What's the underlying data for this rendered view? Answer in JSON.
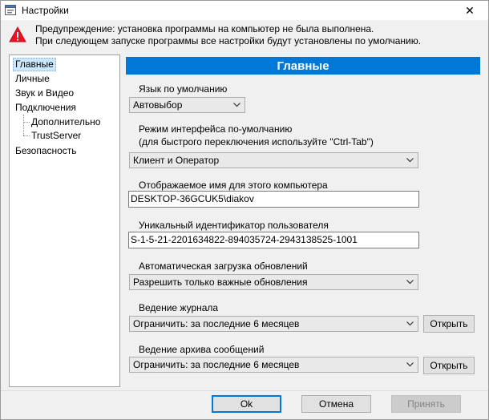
{
  "window": {
    "title": "Настройки",
    "close_glyph": "✕"
  },
  "warning": {
    "line1": "Предупреждение: установка программы на компьютер не была выполнена.",
    "line2": "При следующем запуске программы все настройки будут установлены по умолчанию."
  },
  "tree": {
    "items": [
      {
        "label": "Главные",
        "selected": true
      },
      {
        "label": "Личные"
      },
      {
        "label": "Звук и Видео"
      },
      {
        "label": "Подключения"
      },
      {
        "label": "Дополнительно"
      },
      {
        "label": "TrustServer"
      },
      {
        "label": "Безопасность"
      }
    ]
  },
  "panel": {
    "title": "Главные"
  },
  "language": {
    "label": "Язык по умолчанию",
    "value": "Автовыбор"
  },
  "interface_mode": {
    "label_line1": "Режим интерфейса по-умолчанию",
    "label_line2": "(для быстрого переключения используйте \"Ctrl-Tab\")",
    "value": "Клиент и Оператор"
  },
  "display_name": {
    "label": "Отображаемое имя для этого компьютера",
    "value": "DESKTOP-36GCUK5\\diakov"
  },
  "user_id": {
    "label": "Уникальный идентификатор пользователя",
    "value": "S-1-5-21-2201634822-894035724-2943138525-1001"
  },
  "updates": {
    "label": "Автоматическая загрузка обновлений",
    "value": "Разрешить только важные обновления"
  },
  "logging": {
    "label": "Ведение журнала",
    "value": "Ограничить: за последние 6 месяцев",
    "open_button": "Открыть"
  },
  "archive": {
    "label": "Ведение архива сообщений",
    "value": "Ограничить: за последние 6 месяцев",
    "open_button": "Открыть"
  },
  "footer": {
    "ok": "Ok",
    "cancel": "Отмена",
    "apply": "Принять"
  }
}
